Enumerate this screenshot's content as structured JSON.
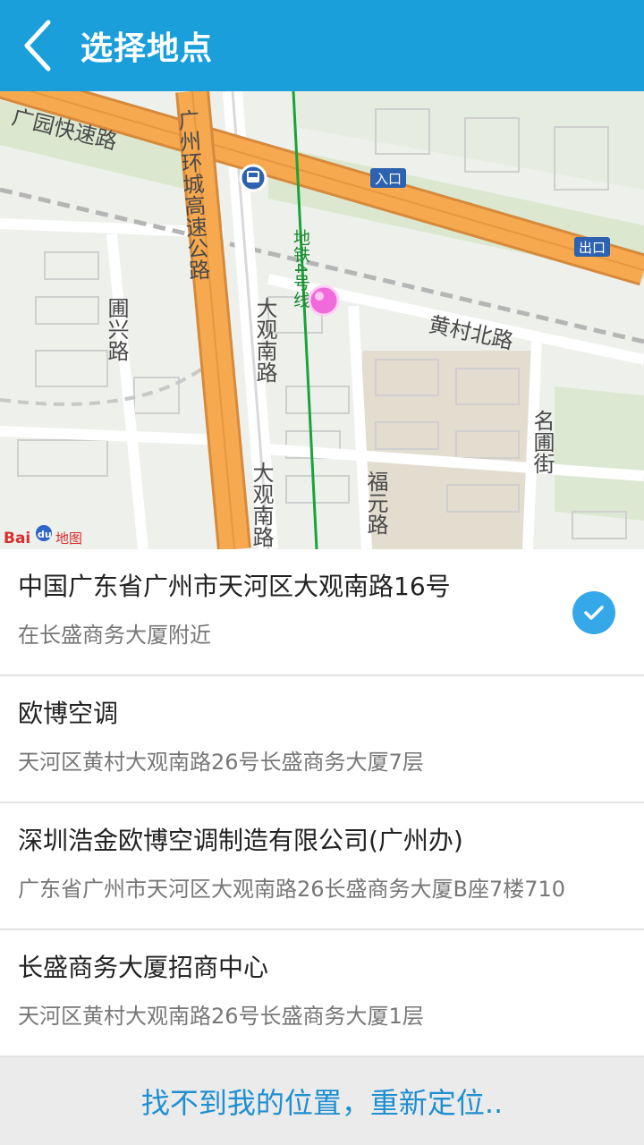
{
  "header": {
    "title": "选择地点",
    "back_icon": "chevron-left-icon"
  },
  "map": {
    "labels": {
      "guangyuan_expressway": "广园快速路",
      "ring_expressway": "广州环城高速公路",
      "metro_line4": "地铁4号线",
      "huangcun_north": "黄村北路",
      "puxing": "圃兴路",
      "daguan_south_1": "大观南路",
      "daguan_south_2": "大观南路",
      "fuyuan": "福元路",
      "mingpu": "名圃街",
      "entrance": "入口",
      "exit": "出口"
    },
    "logo_text": "Baidu地图",
    "bus_stop_icon": "bus-stop-icon",
    "location_pin_icon": "location-pin-icon"
  },
  "results": [
    {
      "name": "中国广东省广州市天河区大观南路16号",
      "address": "在长盛商务大厦附近",
      "selected": true
    },
    {
      "name": "欧博空调",
      "address": "天河区黄村大观南路26号长盛商务大厦7层",
      "selected": false
    },
    {
      "name": "深圳浩金欧博空调制造有限公司(广州办)",
      "address": "广东省广州市天河区大观南路26长盛商务大厦B座7楼710",
      "selected": false
    },
    {
      "name": "长盛商务大厦招商中心",
      "address": "天河区黄村大观南路26号长盛商务大厦1层",
      "selected": false
    }
  ],
  "footer": {
    "relocate_label": "找不到我的位置，重新定位.."
  },
  "colors": {
    "header_bg": "#1a9fda",
    "accent": "#35a8ea",
    "relocate_text": "#1e8fd0",
    "highway": "#f4a04a",
    "metro_line": "#1aa33a"
  }
}
